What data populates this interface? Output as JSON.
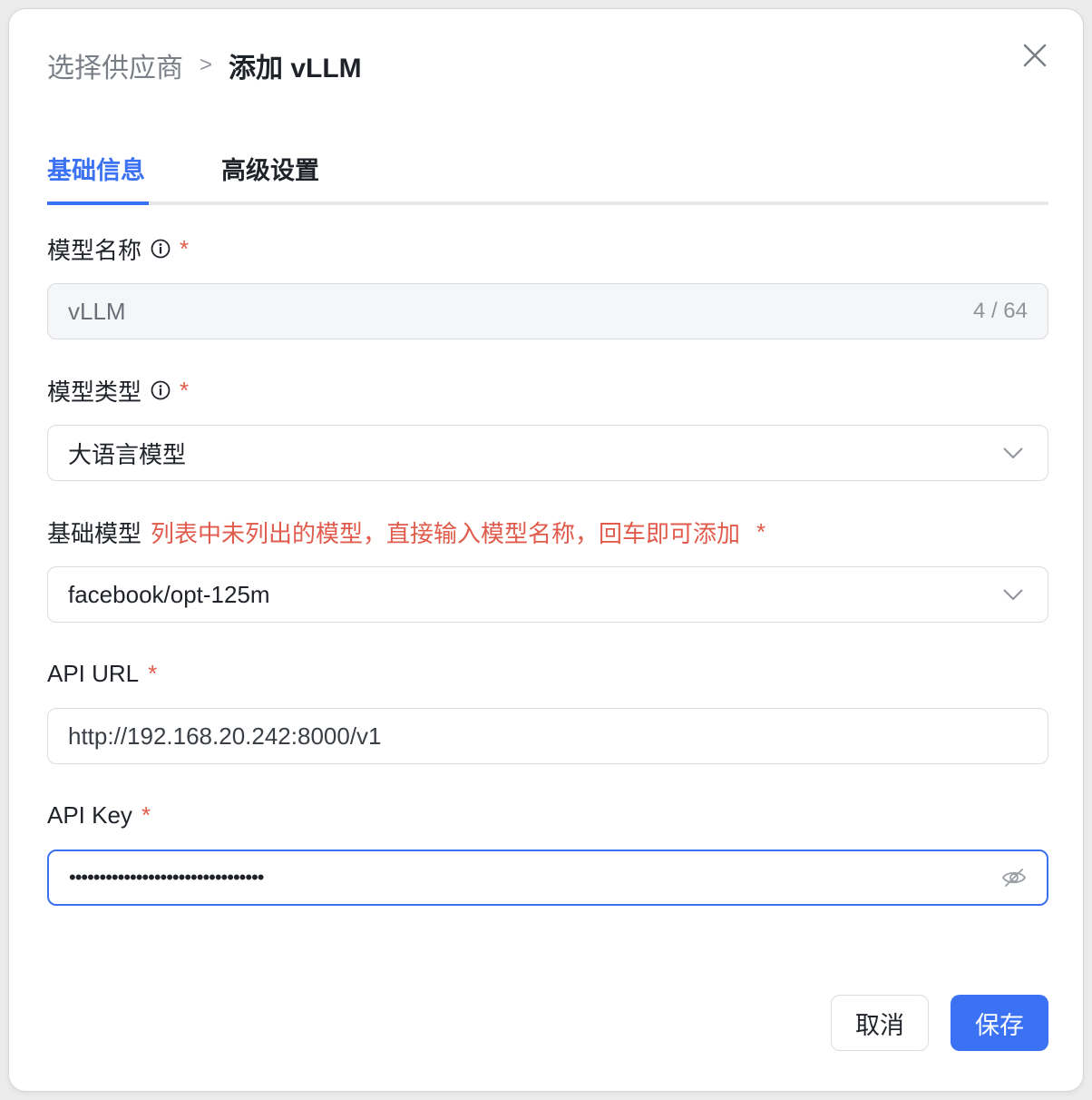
{
  "breadcrumb": {
    "prev": "选择供应商",
    "separator": ">",
    "current": "添加 vLLM"
  },
  "tabs": [
    {
      "label": "基础信息",
      "active": true
    },
    {
      "label": "高级设置",
      "active": false
    }
  ],
  "form": {
    "model_name": {
      "label": "模型名称",
      "required_mark": "*",
      "value": "vLLM",
      "counter": "4 / 64"
    },
    "model_type": {
      "label": "模型类型",
      "required_mark": "*",
      "value": "大语言模型"
    },
    "base_model": {
      "label": "基础模型",
      "hint": "列表中未列出的模型，直接输入模型名称，回车即可添加",
      "required_mark": "*",
      "value": "facebook/opt-125m"
    },
    "api_url": {
      "label": "API URL",
      "required_mark": "*",
      "value": "http://192.168.20.242:8000/v1"
    },
    "api_key": {
      "label": "API Key",
      "required_mark": "*",
      "masked_value": "••••••••••••••••••••••••••••••••"
    }
  },
  "footer": {
    "cancel_label": "取消",
    "save_label": "保存"
  },
  "colors": {
    "accent": "#3b72f3",
    "required": "#e05b4b"
  },
  "icons": [
    "close-icon",
    "info-icon",
    "chevron-down-icon",
    "eye-off-icon"
  ]
}
